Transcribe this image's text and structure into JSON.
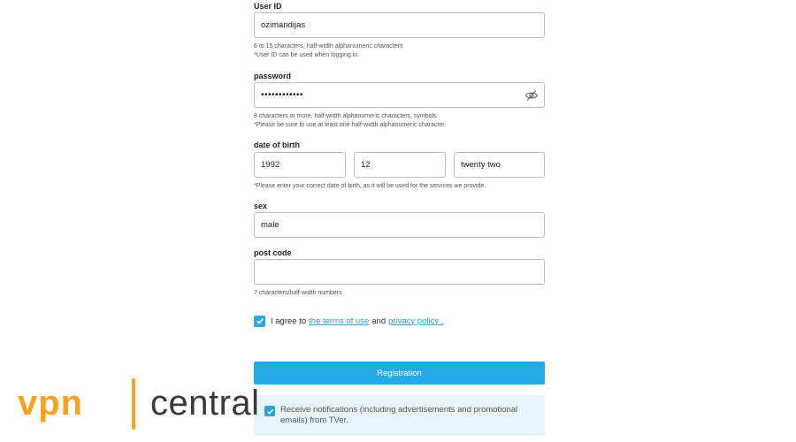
{
  "form": {
    "user_id": {
      "label": "User ID",
      "value": "ozimandijas",
      "hint1": "6 to 15 characters, half-width alphanumeric characters",
      "hint2": "*User ID can be used when logging in."
    },
    "password": {
      "label": "password",
      "value": "••••••••••••",
      "hint1": "8 characters or more, half-width alphanumeric characters, symbols",
      "hint2": "*Please be sure to use at least one half-width alphanumeric character.",
      "toggle_icon": "eye-slash-icon"
    },
    "dob": {
      "label": "date of birth",
      "year": "1992",
      "month": "12",
      "day": "twenty two",
      "hint": "*Please enter your correct date of birth, as it will be used for the services we provide."
    },
    "sex": {
      "label": "sex",
      "value": "male"
    },
    "postcode": {
      "label": "post code",
      "value": "",
      "hint": "7 characters/half-width numbers"
    },
    "agree": {
      "checked": true,
      "prefix": "I agree to",
      "terms_link": "the terms of use",
      "middle": "and",
      "privacy_link": "privacy policy",
      "suffix": "."
    },
    "register_label": "Registration",
    "notify": {
      "checked": true,
      "text": "Receive notifications (including advertisements and promotional emails) from TVer."
    }
  },
  "watermark": {
    "brand_left": "vpn",
    "brand_right": "central"
  },
  "colors": {
    "accent": "#22a9e6",
    "link": "#2a9fd6",
    "notify_bg": "#e8f4fb",
    "watermark_orange": "#f6a21b"
  }
}
